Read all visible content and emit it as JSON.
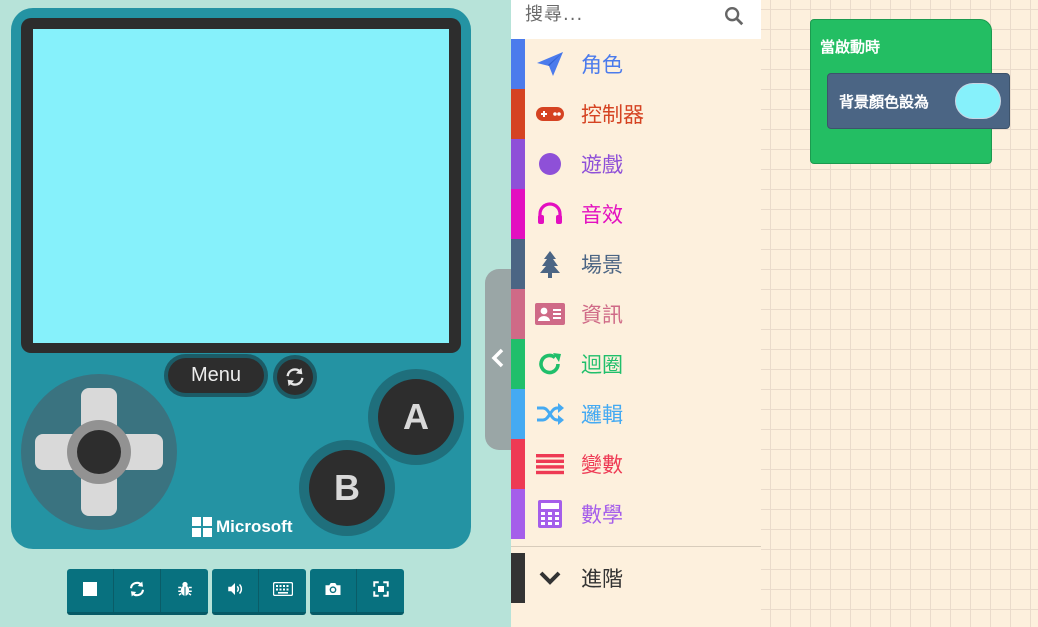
{
  "simulator": {
    "menu_label": "Menu",
    "button_a": "A",
    "button_b": "B",
    "brand": "Microsoft",
    "screen_color": "#86f1fb",
    "toolbar": [
      "stop-icon",
      "restart-icon",
      "debug-icon",
      "sound-icon",
      "keyboard-icon",
      "screenshot-icon",
      "fullscreen-icon"
    ]
  },
  "toolbox": {
    "search_placeholder": "搜尋...",
    "categories": [
      {
        "label": "角色",
        "color": "#4b7bec",
        "icon": "paper-plane-icon"
      },
      {
        "label": "控制器",
        "color": "#d54322",
        "icon": "gamepad-icon"
      },
      {
        "label": "遊戲",
        "color": "#8e50d8",
        "icon": "circle-icon"
      },
      {
        "label": "音效",
        "color": "#e30fc0",
        "icon": "headphones-icon"
      },
      {
        "label": "場景",
        "color": "#4b6584",
        "icon": "tree-icon"
      },
      {
        "label": "資訊",
        "color": "#cf6a87",
        "icon": "id-card-icon"
      },
      {
        "label": "迴圈",
        "color": "#20bf6b",
        "icon": "loop-arrow-icon"
      },
      {
        "label": "邏輯",
        "color": "#45aaf2",
        "icon": "shuffle-icon"
      },
      {
        "label": "變數",
        "color": "#ee3a54",
        "icon": "list-icon"
      },
      {
        "label": "數學",
        "color": "#a55eea",
        "icon": "calculator-icon"
      }
    ],
    "advanced": {
      "label": "進階",
      "color": "#333333",
      "icon": "chevron-down-icon"
    }
  },
  "workspace": {
    "on_start_label": "當啟動時",
    "set_background_label": "背景顏色設為",
    "background_color_value": "#86f1fb"
  }
}
